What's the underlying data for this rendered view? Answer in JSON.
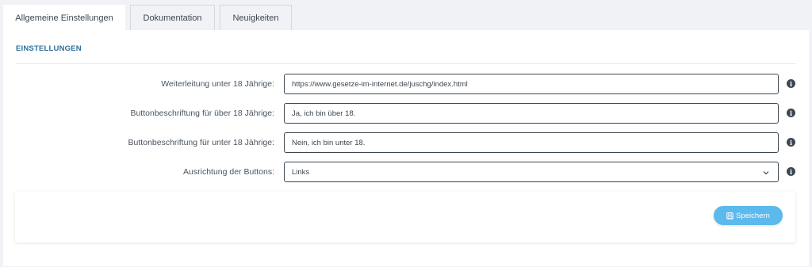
{
  "tabs": [
    {
      "label": "Allgemeine Einstellungen",
      "active": true
    },
    {
      "label": "Dokumentation",
      "active": false
    },
    {
      "label": "Neuigkeiten",
      "active": false
    }
  ],
  "section": {
    "title": "EINSTELLUNGEN"
  },
  "fields": [
    {
      "label": "Weiterleitung unter 18 Jährige:",
      "value": "https://www.gesetze-im-internet.de/juschg/index.html"
    },
    {
      "label": "Buttonbeschriftung für über 18 Jährige:",
      "value": "Ja, ich bin über 18."
    },
    {
      "label": "Buttonbeschriftung für unter 18 Jährige:",
      "value": "Nein, ich bin unter 18."
    },
    {
      "label": "Ausrichtung der Buttons:",
      "value": "Links"
    }
  ],
  "info_icon": "info-icon",
  "save_button": {
    "label": "Speichern",
    "icon": "floppy-disk-icon",
    "color": "#5bb9ec"
  },
  "colors": {
    "accent": "#2f6f98",
    "background": "#f0f2f5"
  }
}
